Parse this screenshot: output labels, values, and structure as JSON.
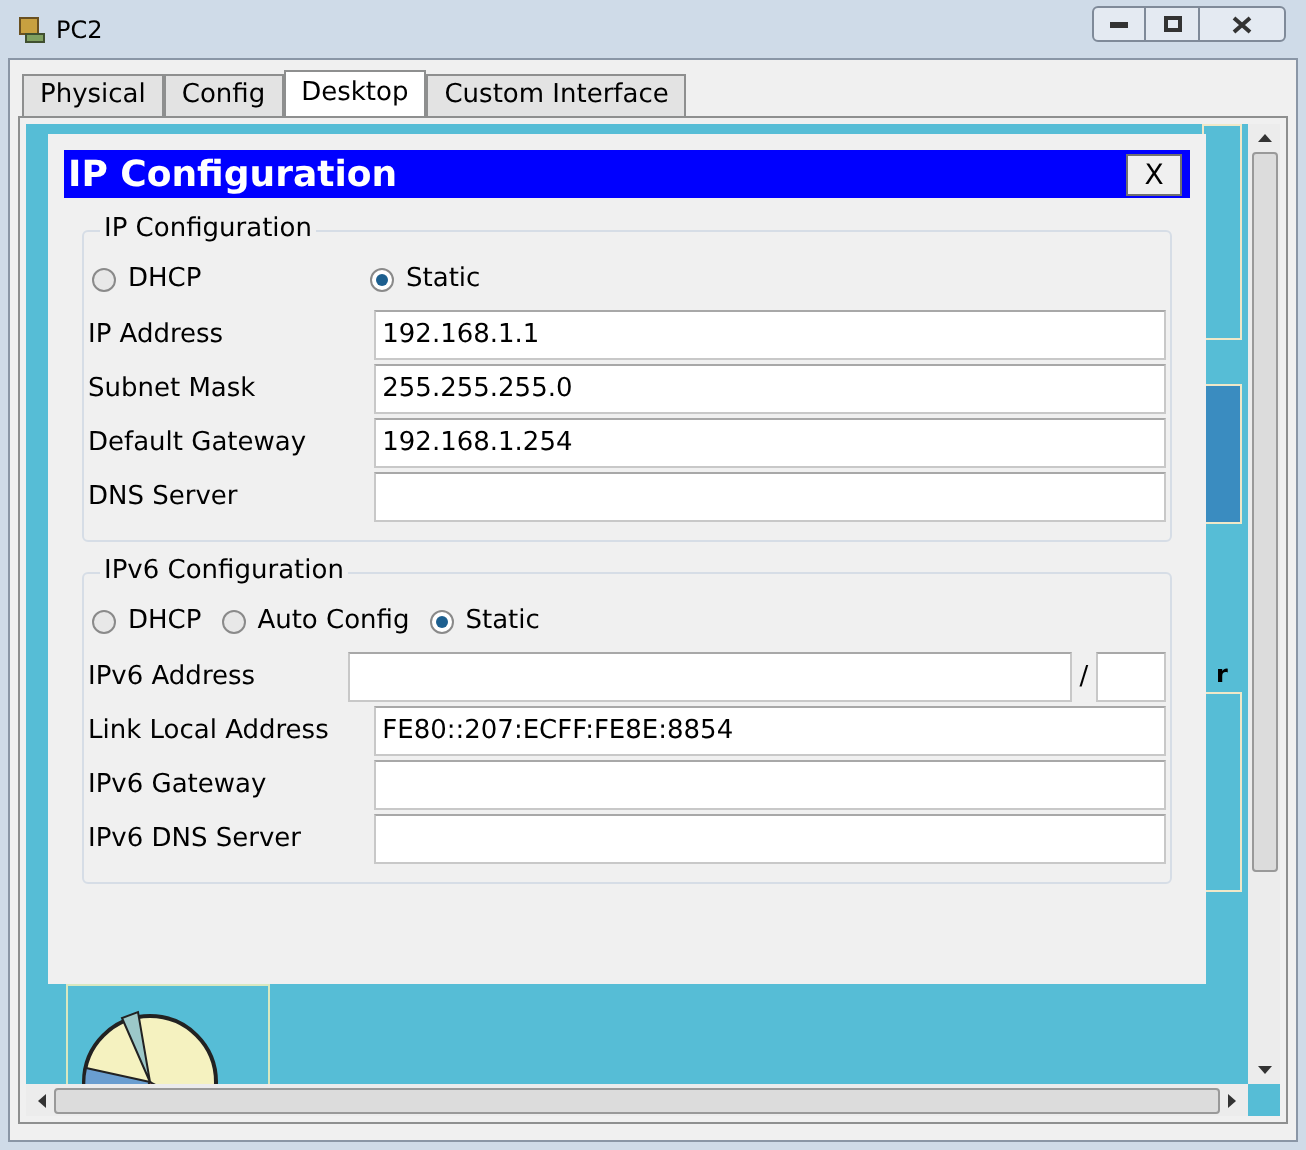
{
  "window": {
    "title": "PC2"
  },
  "tabs": [
    {
      "label": "Physical",
      "selected": false
    },
    {
      "label": "Config",
      "selected": false
    },
    {
      "label": "Desktop",
      "selected": true
    },
    {
      "label": "Custom Interface",
      "selected": false
    }
  ],
  "desktop": {
    "tile_text": "r"
  },
  "dialog": {
    "title": "IP Configuration",
    "close": "X",
    "ipv4": {
      "legend": "IP Configuration",
      "modes": [
        {
          "label": "DHCP",
          "selected": false
        },
        {
          "label": "Static",
          "selected": true
        }
      ],
      "fields": [
        {
          "label": "IP Address",
          "value": "192.168.1.1"
        },
        {
          "label": "Subnet Mask",
          "value": "255.255.255.0"
        },
        {
          "label": "Default Gateway",
          "value": "192.168.1.254"
        },
        {
          "label": "DNS Server"
        }
      ]
    },
    "ipv6": {
      "legend": "IPv6 Configuration",
      "modes": [
        {
          "label": "DHCP",
          "selected": false
        },
        {
          "label": "Auto Config",
          "selected": false
        },
        {
          "label": "Static",
          "selected": true
        }
      ],
      "fields": [
        {
          "label": "IPv6 Address",
          "kind": "prefixed",
          "separator": "/"
        },
        {
          "label": "Link Local Address",
          "kind": "plain",
          "value": "FE80::207:ECFF:FE8E:8854"
        },
        {
          "label": "IPv6 Gateway",
          "kind": "plain"
        },
        {
          "label": "IPv6 DNS Server",
          "kind": "plain"
        }
      ]
    }
  }
}
